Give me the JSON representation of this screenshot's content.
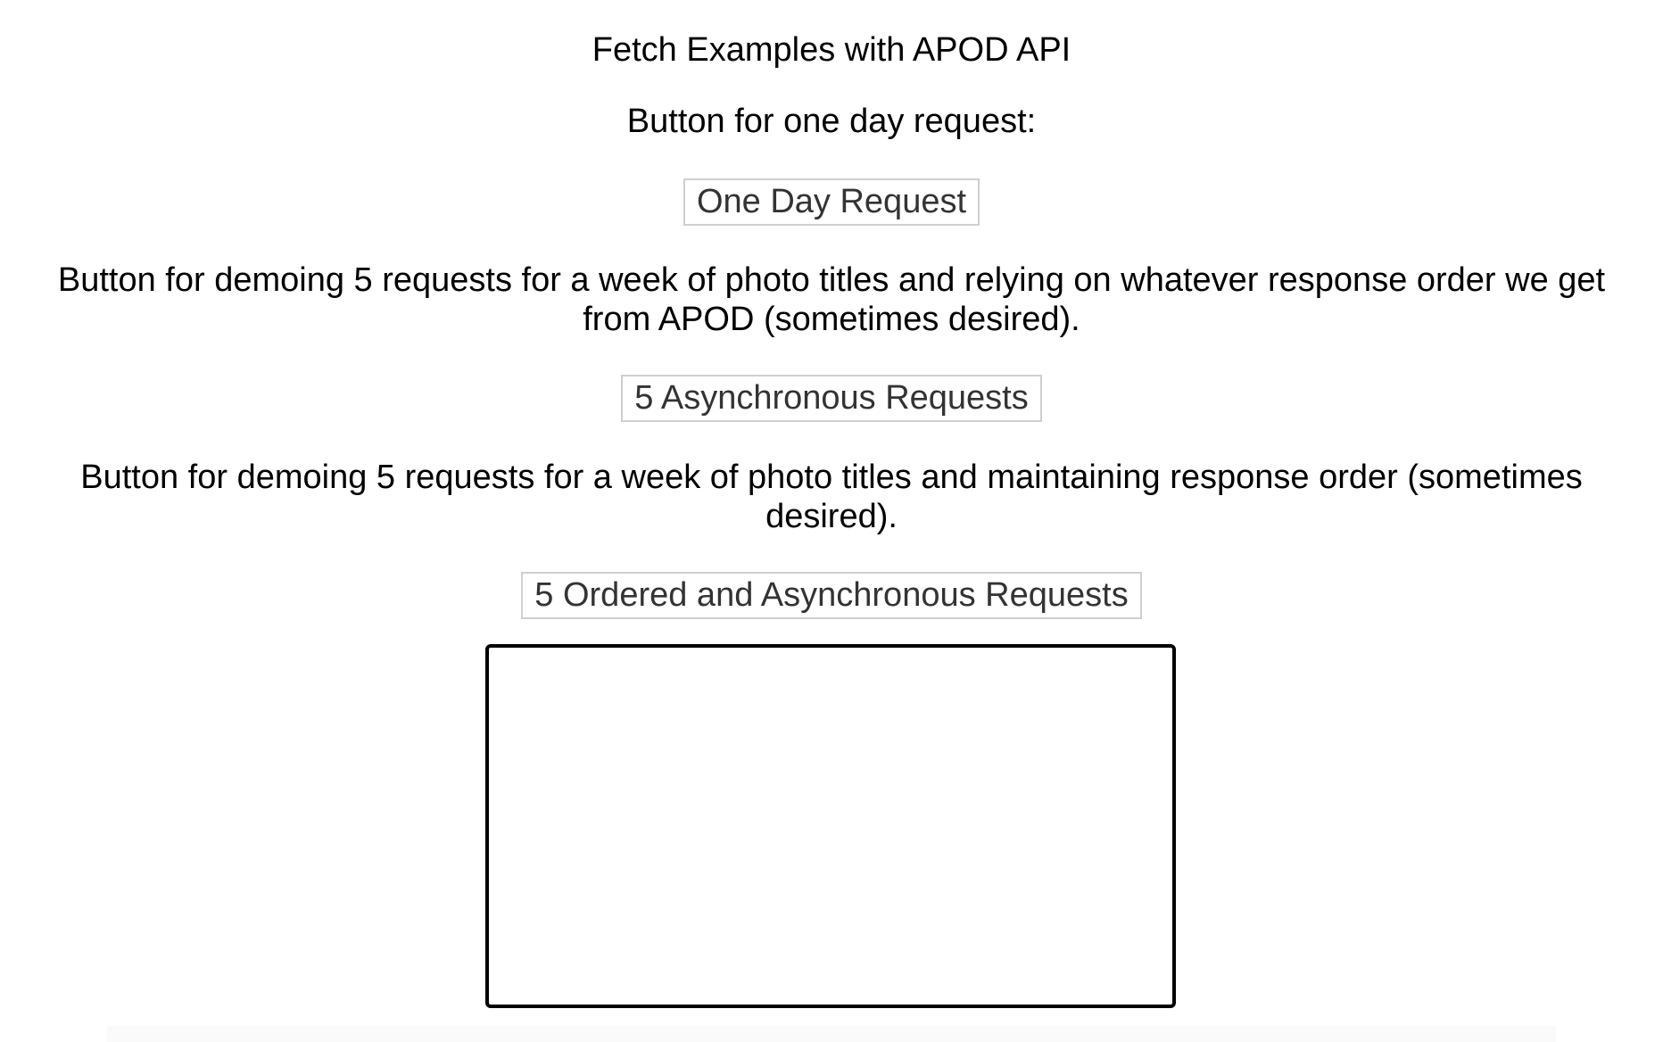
{
  "page": {
    "title": "Fetch Examples with APOD API"
  },
  "sections": {
    "one_day": {
      "description": "Button for one day request:",
      "button_label": "One Day Request"
    },
    "async": {
      "description": "Button for demoing 5 requests for a week of photo titles and relying on whatever response order we get from APOD (sometimes desired).",
      "button_label": "5 Asynchronous Requests"
    },
    "ordered": {
      "description": "Button for demoing 5 requests for a week of photo titles and maintaining response order (sometimes desired).",
      "button_label": "5 Ordered and Asynchronous Requests"
    }
  },
  "output": {
    "content": ""
  },
  "colors": {
    "button_border": "#cfcfcf",
    "button_text": "#333333",
    "output_border": "#000000"
  }
}
